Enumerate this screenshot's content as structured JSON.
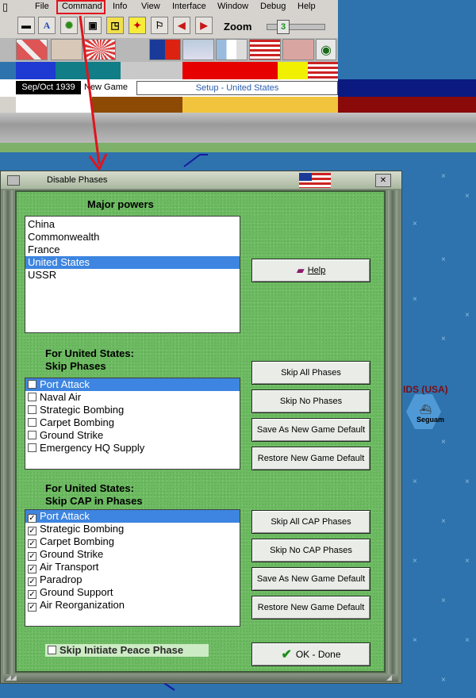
{
  "menu": {
    "items": [
      "File",
      "Command",
      "Info",
      "View",
      "Interface",
      "Window",
      "Debug",
      "Help"
    ],
    "highlighted": "Command"
  },
  "toolbar": {
    "zoom_label": "Zoom",
    "zoom_value": "3"
  },
  "status": {
    "date": "Sep/Oct 1939",
    "game_type": "New Game",
    "setup": "Setup - United States"
  },
  "dialog": {
    "title": "Disable Phases",
    "major_powers_label": "Major powers",
    "major_powers": [
      "China",
      "Commonwealth",
      "France",
      "United States",
      "USSR"
    ],
    "selected_power": "United States",
    "help_label": "Help",
    "skip_phases_label_1": "For United States:",
    "skip_phases_label_2": "Skip Phases",
    "skip_phases": [
      {
        "label": "Port Attack",
        "checked": false,
        "selected": true
      },
      {
        "label": "Naval Air",
        "checked": false,
        "selected": false
      },
      {
        "label": "Strategic Bombing",
        "checked": false,
        "selected": false
      },
      {
        "label": "Carpet Bombing",
        "checked": false,
        "selected": false
      },
      {
        "label": "Ground Strike",
        "checked": false,
        "selected": false
      },
      {
        "label": "Emergency HQ Supply",
        "checked": false,
        "selected": false
      }
    ],
    "skip_all_phases": "Skip All Phases",
    "skip_no_phases": "Skip No Phases",
    "save_default_1": "Save As New Game Default",
    "restore_default_1": "Restore New Game Default",
    "skip_cap_label_1": "For United States:",
    "skip_cap_label_2": "Skip CAP in Phases",
    "skip_cap": [
      {
        "label": "Port Attack",
        "checked": true,
        "selected": true
      },
      {
        "label": "Strategic Bombing",
        "checked": true,
        "selected": false
      },
      {
        "label": "Carpet Bombing",
        "checked": true,
        "selected": false
      },
      {
        "label": "Ground Strike",
        "checked": true,
        "selected": false
      },
      {
        "label": "Air Transport",
        "checked": true,
        "selected": false
      },
      {
        "label": "Paradrop",
        "checked": true,
        "selected": false
      },
      {
        "label": "Ground Support",
        "checked": true,
        "selected": false
      },
      {
        "label": "Air Reorganization",
        "checked": true,
        "selected": false
      }
    ],
    "skip_all_cap": "Skip All CAP Phases",
    "skip_no_cap": "Skip No CAP Phases",
    "save_default_2": "Save As New Game Default",
    "restore_default_2": "Restore New Game Default",
    "peace_label": "Skip Initiate Peace Phase",
    "peace_checked": false,
    "ok_label": "OK - Done"
  },
  "map": {
    "region_label": "IDS (USA)",
    "hex_label": "Seguam"
  }
}
